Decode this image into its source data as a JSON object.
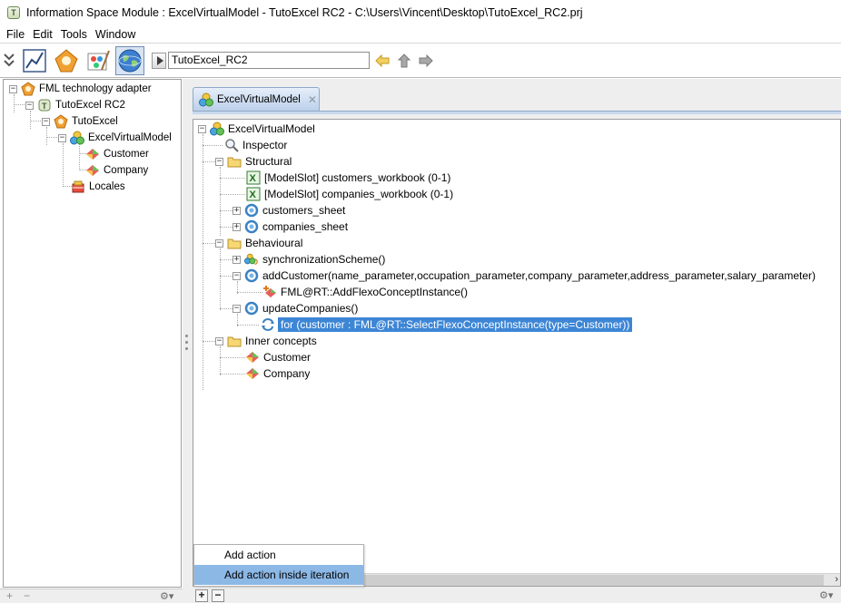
{
  "window": {
    "title": "Information Space Module : ExcelVirtualModel - TutoExcel RC2 - C:\\Users\\Vincent\\Desktop\\TutoExcel_RC2.prj"
  },
  "menu": {
    "items": [
      "File",
      "Edit",
      "Tools",
      "Window"
    ]
  },
  "toolbar": {
    "address_value": "TutoExcel_RC2"
  },
  "left_tree": {
    "items": [
      {
        "label": "FML technology adapter"
      },
      {
        "label": "TutoExcel RC2"
      },
      {
        "label": "TutoExcel"
      },
      {
        "label": "ExcelVirtualModel"
      },
      {
        "label": "Customer"
      },
      {
        "label": "Company"
      },
      {
        "label": "Locales"
      }
    ]
  },
  "tab": {
    "label": "ExcelVirtualModel"
  },
  "main_tree": {
    "items": [
      {
        "label": "ExcelVirtualModel"
      },
      {
        "label": "Inspector"
      },
      {
        "label": "Structural"
      },
      {
        "label": "[ModelSlot] customers_workbook (0-1)"
      },
      {
        "label": "[ModelSlot] companies_workbook (0-1)"
      },
      {
        "label": "customers_sheet"
      },
      {
        "label": "companies_sheet"
      },
      {
        "label": "Behavioural"
      },
      {
        "label": "synchronizationScheme()"
      },
      {
        "label": "addCustomer(name_parameter,occupation_parameter,company_parameter,address_parameter,salary_parameter)"
      },
      {
        "label": "FML@RT::AddFlexoConceptInstance()"
      },
      {
        "label": "updateCompanies()"
      },
      {
        "label": "for (customer : FML@RT::SelectFlexoConceptInstance(type=Customer))"
      },
      {
        "label": "Inner concepts"
      },
      {
        "label": "Customer"
      },
      {
        "label": "Company"
      }
    ]
  },
  "context_menu": {
    "items": [
      "Add action",
      "Add action inside iteration"
    ]
  },
  "colors": {
    "selection": "#3d86d6",
    "menu_highlight": "#8cb8e6",
    "tab_gradient_bottom": "#bcd0ea"
  }
}
